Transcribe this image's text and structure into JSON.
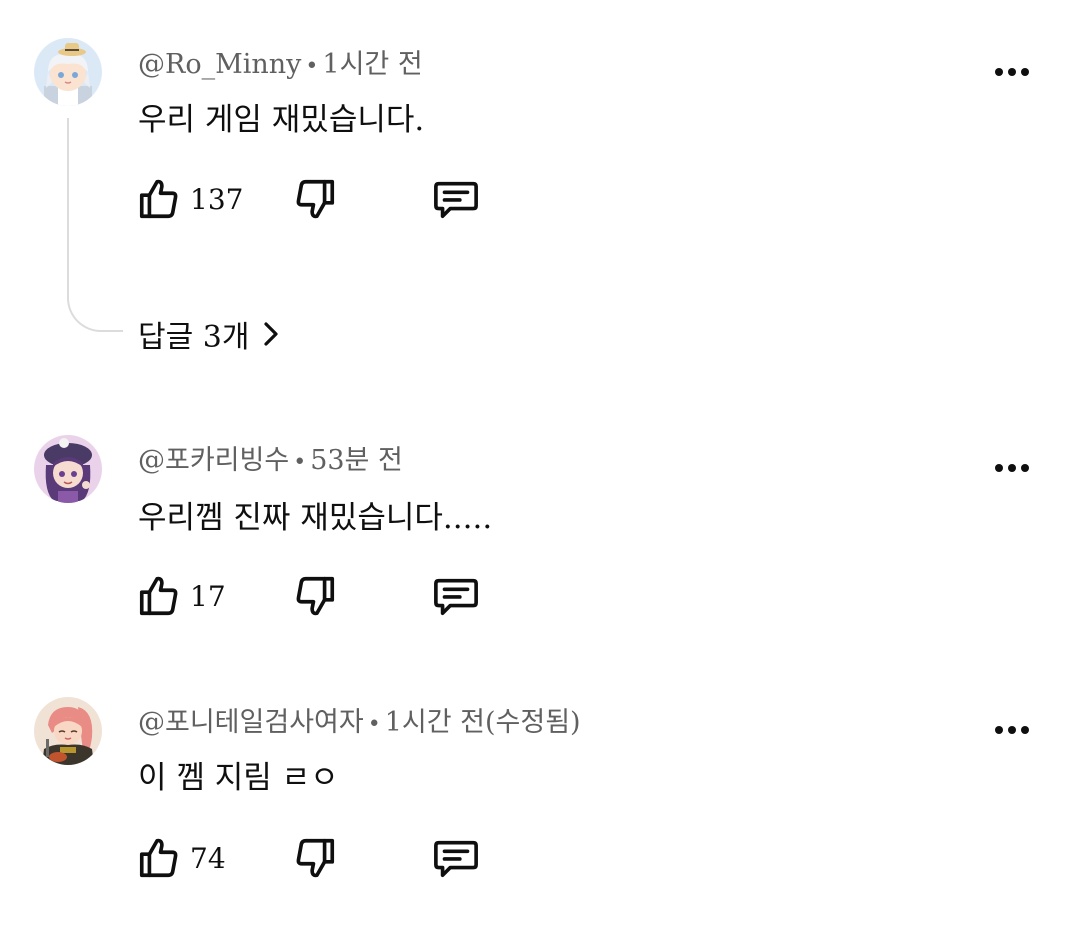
{
  "comments": [
    {
      "author": "@Ro_Minny",
      "separator": "•",
      "time": "1시간 전",
      "text": "우리 게임 재밌습니다.",
      "likes": "137",
      "replies_label": "답글 3개",
      "avatar_colors": {
        "bg": "#dbe9f7",
        "hair": "#f2f3f7",
        "hat": "#e8c988",
        "skin": "#fbe3d2"
      }
    },
    {
      "author": "@포카리빙수",
      "separator": "•",
      "time": "53분 전",
      "text": "우리껨 진짜 재밌습니다.....",
      "likes": "17",
      "avatar_colors": {
        "bg": "#ead3ea",
        "hair": "#5a3a78",
        "hat": "#4a3a66",
        "skin": "#f6dcd0"
      }
    },
    {
      "author": "@포니테일검사여자",
      "separator": "•",
      "time": "1시간 전(수정됨)",
      "text": "이 껨 지림 ㄹㅇ",
      "likes": "74",
      "avatar_colors": {
        "bg": "#f1e2d6",
        "hair": "#e98c86",
        "armor": "#3c352c",
        "skin": "#f8d8c4"
      }
    }
  ],
  "icons": {
    "like": "thumbs-up-icon",
    "dislike": "thumbs-down-icon",
    "reply": "comment-icon",
    "more": "more-horizontal-icon",
    "expand": "chevron-right-icon"
  },
  "colors": {
    "text": "#0f0f0f",
    "meta": "#606060",
    "thread_line": "#dcdcdc",
    "background": "#ffffff"
  }
}
